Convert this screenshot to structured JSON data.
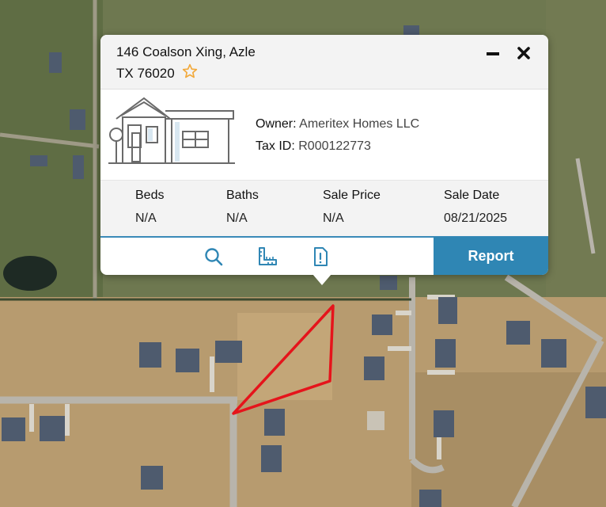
{
  "popup": {
    "address_line1": "146 Coalson Xing, Azle",
    "address_line2": "TX 76020",
    "owner_label": "Owner:",
    "owner_value": "Ameritex Homes LLC",
    "taxid_label": "Tax ID:",
    "taxid_value": "R000122773",
    "stats": [
      {
        "label": "Beds",
        "value": "N/A"
      },
      {
        "label": "Baths",
        "value": "N/A"
      },
      {
        "label": "Sale Price",
        "value": "N/A"
      },
      {
        "label": "Sale Date",
        "value": "08/21/2025"
      }
    ],
    "tools": [
      "search-icon",
      "ruler-icon",
      "report-issue-icon"
    ],
    "report_label": "Report"
  },
  "colors": {
    "accent": "#2f86b4",
    "star": "#f2a93b",
    "parcel_outline": "#e5141b"
  }
}
